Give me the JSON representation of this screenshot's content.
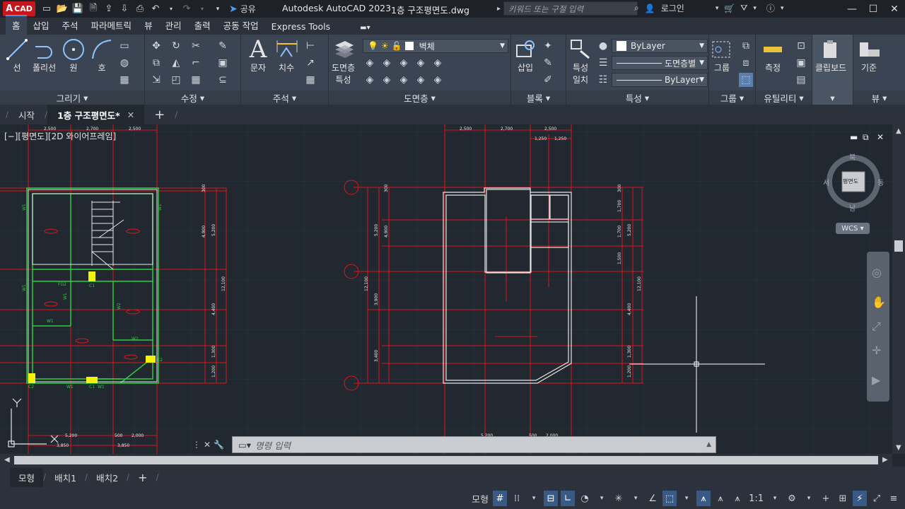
{
  "titlebar": {
    "logo_letter": "A",
    "logo_text": "CAD",
    "share_label": "공유",
    "app_title": "Autodesk AutoCAD 2023",
    "doc_title": "1층 구조평면도.dwg",
    "search_placeholder": "키워드 또는 구절 입력",
    "login_label": "로그인"
  },
  "ribbon_tabs": [
    "홈",
    "삽입",
    "주석",
    "파라메트릭",
    "뷰",
    "관리",
    "출력",
    "공동 작업",
    "Express Tools"
  ],
  "ribbon": {
    "draw": {
      "title": "그리기",
      "line": "선",
      "polyline": "폴리선",
      "circle": "원",
      "arc": "호"
    },
    "modify": {
      "title": "수정"
    },
    "annotation": {
      "title": "주석",
      "text": "문자",
      "dimension": "치수"
    },
    "layers": {
      "title": "도면층",
      "properties": "도면층\n특성",
      "properties_l1": "도면층",
      "properties_l2": "특성",
      "current_layer": "벽체"
    },
    "block": {
      "title": "블록",
      "insert": "삽입"
    },
    "properties": {
      "title": "특성",
      "match_l1": "특성",
      "match_l2": "일치",
      "color": "ByLayer",
      "linetype": "도면층별",
      "lineweight": "ByLayer"
    },
    "groups": {
      "title": "그룹",
      "group": "그룹"
    },
    "utilities": {
      "title": "유틸리티",
      "measure": "측정"
    },
    "clipboard": {
      "title": "클립보드"
    },
    "view": {
      "title": "뷰",
      "base": "기준"
    }
  },
  "doc_tabs": {
    "start": "시작",
    "active": "1층 구조평면도*"
  },
  "viewport": {
    "label": "[−][평면도][2D 와이어프레임]",
    "cube": {
      "top": "평면도",
      "n": "북",
      "s": "남",
      "e": "동",
      "w": "서"
    },
    "wcs": "WCS"
  },
  "drawing_text": {
    "dims_top": [
      "2,500",
      "2,700",
      "2,500"
    ],
    "dims_top_sub": [
      "1,250",
      "1,250"
    ],
    "dims_right": [
      "300",
      "5,200",
      "4,900",
      "12,100",
      "4,400",
      "1,300",
      "1,200"
    ],
    "dims_left": [
      "300",
      "5,200",
      "4,900",
      "12,100",
      "3,900",
      "3,400"
    ],
    "dims_right_b": [
      "300",
      "1,700",
      "1,700",
      "1,500",
      "5,200",
      "12,100",
      "4,400",
      "1,300",
      "1,200"
    ],
    "dims_bottom": [
      "5,200",
      "500",
      "2,000",
      "3,850",
      "3,850"
    ],
    "plan_labels": [
      "W1",
      "W1",
      "W1",
      "W1",
      "W1",
      "W1",
      "W2",
      "W2",
      "C1",
      "C1",
      "C2",
      "C2",
      "FG2",
      "W1"
    ]
  },
  "command": {
    "placeholder": "명령 입력"
  },
  "layout_tabs": [
    "모형",
    "배치1",
    "배치2"
  ],
  "status": {
    "model": "모형",
    "scale": "1:1"
  },
  "colors": {
    "accent": "#4f90e2",
    "logo": "#c8161d",
    "grid": "#2d3540",
    "dim": "#e0141c",
    "wall": "#e6e6e6",
    "green": "#2ecc40",
    "yellow": "#f2f20a"
  }
}
